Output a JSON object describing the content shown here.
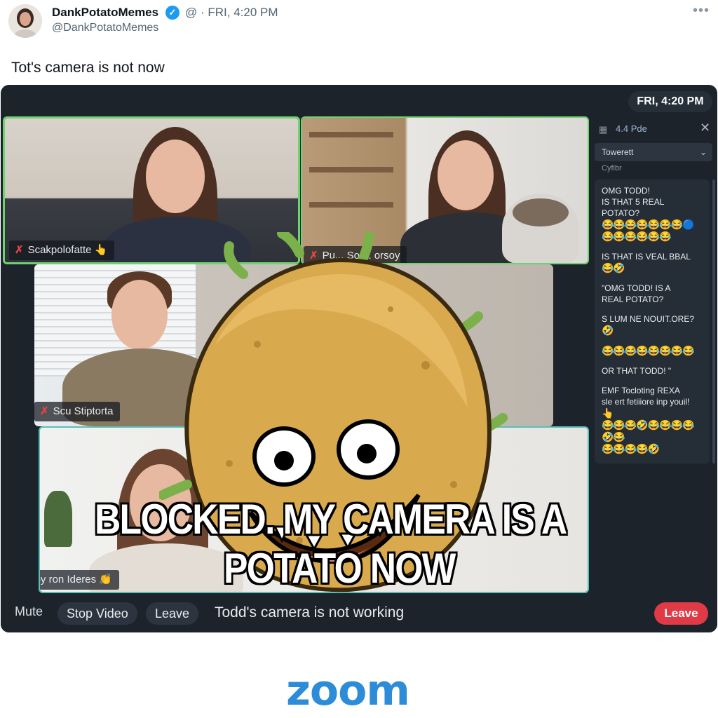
{
  "tweet": {
    "user_name": "DankPotatoMemes",
    "meta": "@ · FRI, 4:20 PM",
    "handle": "@DankPotatoMemes",
    "more_icon": "ellipsis-icon",
    "caption": "Tot's camera is not now"
  },
  "zoom": {
    "clock": "FRI, 4:20 PM",
    "participants": [
      {
        "name": "Scakpolofatte",
        "badge": "👆"
      },
      {
        "name": "Pu... Sor... orsoy",
        "badge": ""
      },
      {
        "name": "Scu Stiptorta",
        "badge": ""
      },
      {
        "name": "Soy ron Ideres",
        "badge": "👏"
      }
    ],
    "chat": {
      "header_count": "4.4",
      "header_title": "Pde",
      "select_label": "Towerett",
      "sub_label": "Cyfibr",
      "messages": [
        {
          "text": "OMG TODD!\nIS THAT 5 REAL POTATO?",
          "emoji": "😂😂😂😂😂😂😂🔵\n😂😂😂😂😂😂"
        },
        {
          "text": "IS THAT IS VEAL BBAL",
          "emoji": "😂🤣"
        },
        {
          "text": "\"OMG TODD! IS A\n REAL POTATO?",
          "emoji": ""
        },
        {
          "text": "S LUM NE NOUIT.ORE?",
          "emoji": "🤣"
        },
        {
          "text": "",
          "emoji": "😂😂😂😂😂😂😂😂"
        },
        {
          "text": "OR THAT TODD! \"",
          "emoji": ""
        },
        {
          "text": "EMF Tocloting REXA\nsle ert fetiiiore inp youil!",
          "emoji": "👆\n😂😂😂🤣😂😂😂😂\n🤣😂\n😂😂😂😂🤣"
        }
      ]
    },
    "meme_line1": "BLOCKED. MY CAMERA IS A",
    "meme_line2": "POTATO NOW",
    "toolbar": {
      "mute": "Mute",
      "stop_video": "Stop Video",
      "leave_pill": "Leave",
      "status": "Todd's camera is not working",
      "leave_button": "Leave"
    }
  },
  "zoom_logo": "zoom",
  "colors": {
    "accent_green": "#6fd16f",
    "accent_teal": "#56c1b8",
    "leave_red": "#df3a45",
    "zoom_blue": "#2d8cd8",
    "verified_blue": "#1d9bf0"
  }
}
